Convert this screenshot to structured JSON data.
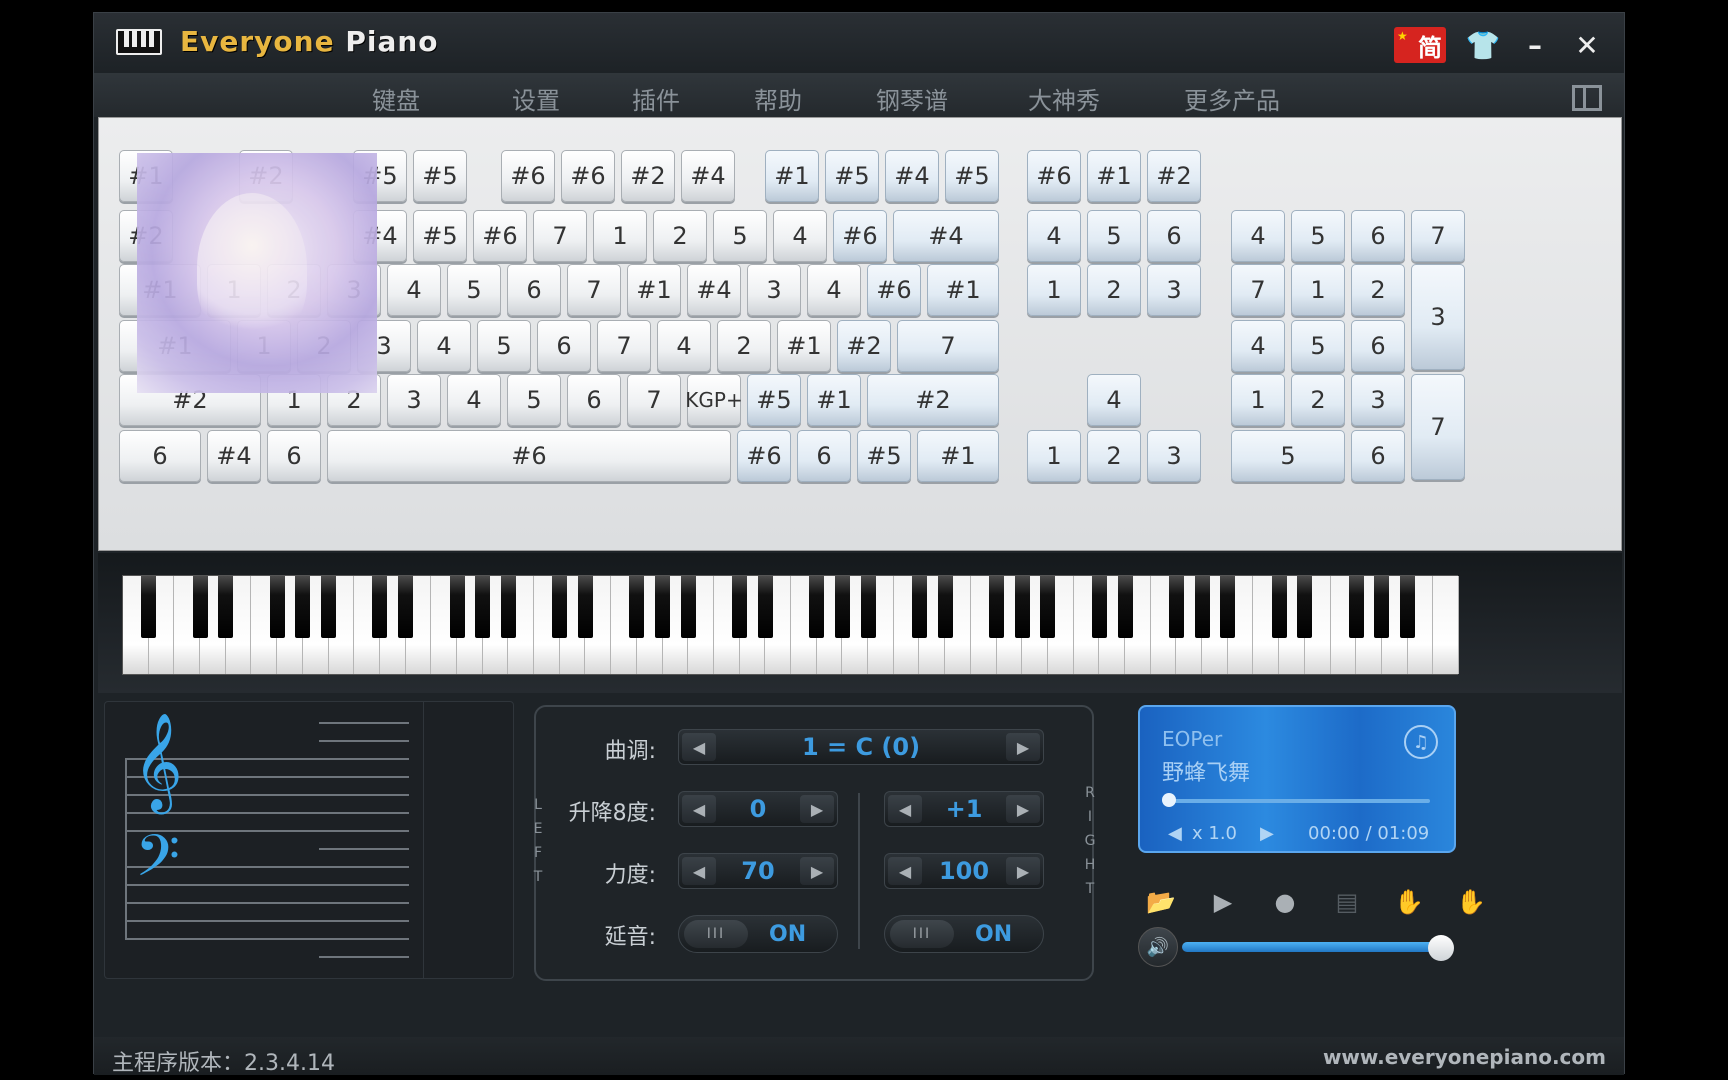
{
  "app": {
    "title_a": "Everyone",
    "title_b": " Piano",
    "lang_label": "简"
  },
  "menu": {
    "items": [
      "键盘",
      "设置",
      "插件",
      "帮助",
      "钢琴谱",
      "大神秀",
      "更多产品"
    ]
  },
  "keys": {
    "row1": [
      "#1",
      "#2",
      "#5",
      "#5",
      "#6",
      "#6",
      "#2",
      "#4",
      "#1",
      "#5",
      "#4",
      "#5",
      "#6",
      "#1",
      "#2"
    ],
    "row2": [
      "#2",
      "#4",
      "#5",
      "#6",
      "7",
      "1",
      "2",
      "5",
      "4",
      "#6",
      "#4",
      "4",
      "5",
      "6",
      "4",
      "5",
      "6",
      "7"
    ],
    "row3": [
      "#1",
      "1",
      "2",
      "3",
      "4",
      "5",
      "6",
      "7",
      "#1",
      "#4",
      "3",
      "4",
      "#6",
      "#1",
      "1",
      "2",
      "3",
      "7",
      "1",
      "2",
      "3"
    ],
    "row4": [
      "#1",
      "1",
      "2",
      "3",
      "4",
      "5",
      "6",
      "7",
      "4",
      "2",
      "#1",
      "#2",
      "7",
      "4",
      "5",
      "6"
    ],
    "row5": [
      "#2",
      "1",
      "2",
      "3",
      "4",
      "5",
      "6",
      "7",
      "KGP+",
      "#5",
      "#1",
      "#2",
      "4",
      "1",
      "2",
      "3",
      "7"
    ],
    "row6": [
      "6",
      "#4",
      "6",
      "#6",
      "#6",
      "6",
      "#5",
      "#1",
      "1",
      "2",
      "3",
      "5",
      "6"
    ]
  },
  "controls": {
    "key_label": "曲调:",
    "key_value": "1 = C (0)",
    "octave_label": "升降8度:",
    "octave_left": "0",
    "octave_right": "+1",
    "velocity_label": "力度:",
    "velocity_left": "70",
    "velocity_right": "100",
    "sustain_label": "延音:",
    "sustain_left": "ON",
    "sustain_right": "ON",
    "knob_text": "III",
    "left_label": [
      "L",
      "E",
      "F",
      "T"
    ],
    "right_label": [
      "R",
      "I",
      "G",
      "H",
      "T"
    ]
  },
  "player": {
    "artist": "EOPer",
    "song": "野蜂飞舞",
    "speed": "x 1.0",
    "time": "00:00 / 01:09",
    "progress": 0
  },
  "volume": {
    "level": 1.0
  },
  "status": {
    "version": "主程序版本：2.3.4.14",
    "website": "www.everyonepiano.com"
  },
  "colors": {
    "accent": "#3d9be0",
    "title_gold": "#e8b640",
    "green_hand": "#8ed320",
    "blue_hand": "#39a5e8"
  }
}
